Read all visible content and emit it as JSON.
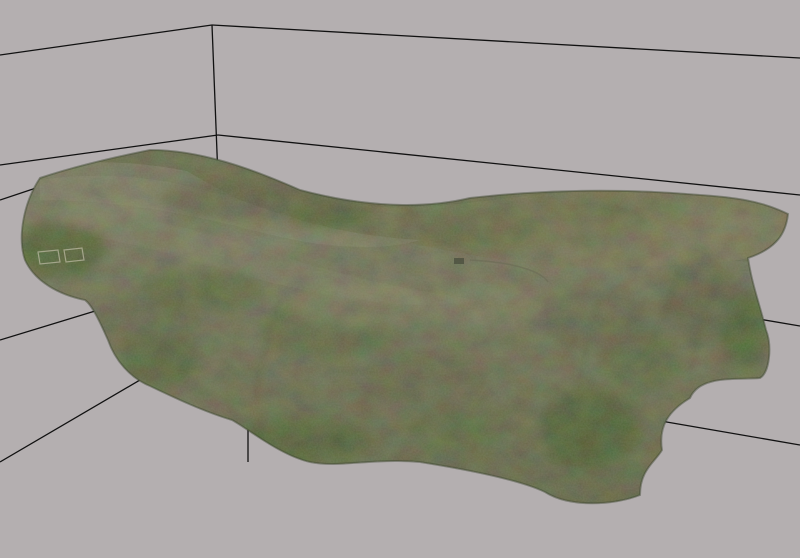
{
  "viewer": {
    "background_color": "#b4afb0",
    "grid_line_color": "#111111",
    "model": {
      "kind": "textured-terrain-mesh",
      "palette": {
        "cliff_rock": "#9a9a86",
        "cliff_shadow": "#6f7360",
        "grass_dark": "#4d6a35",
        "grass_mid": "#6f7f52",
        "plateau_light": "#9b9a7c",
        "plateau_shadow": "#5f6449",
        "soil": "#a39a7d",
        "edge_dark": "#3f4633"
      }
    }
  }
}
